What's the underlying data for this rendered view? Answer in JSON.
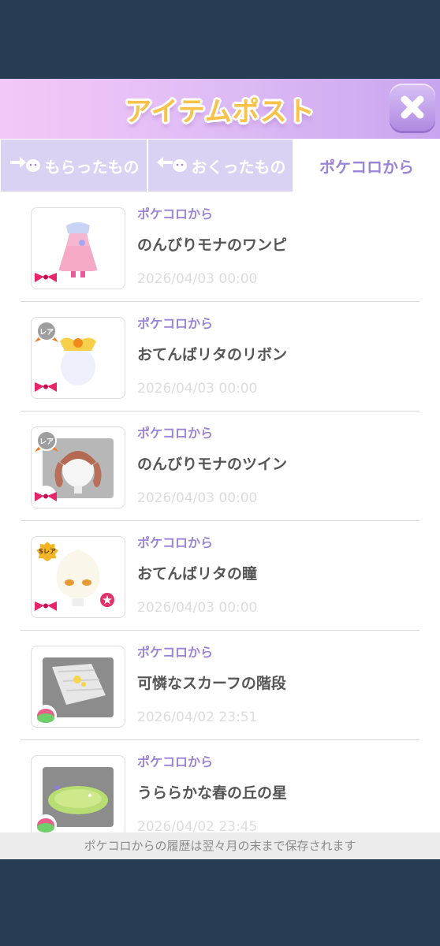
{
  "header": {
    "title": "アイテムポスト"
  },
  "tabs": [
    {
      "label": "もらったもの",
      "icon": "received-arrow-icon",
      "active": false
    },
    {
      "label": "おくったもの",
      "icon": "sent-arrow-icon",
      "active": false
    },
    {
      "label": "ポケコロから",
      "active": true
    }
  ],
  "items": [
    {
      "source": "ポケコロから",
      "name": "のんびりモナのワンピ",
      "date": "2026/04/03 00:00",
      "rarity": "",
      "thumb": "pink-dress"
    },
    {
      "source": "ポケコロから",
      "name": "おてんばリタのリボン",
      "date": "2026/04/03 00:00",
      "rarity": "レア",
      "thumb": "ribbon"
    },
    {
      "source": "ポケコロから",
      "name": "のんびりモナのツイン",
      "date": "2026/04/03 00:00",
      "rarity": "レア",
      "thumb": "twin-hair"
    },
    {
      "source": "ポケコロから",
      "name": "おてんばリタの瞳",
      "date": "2026/04/03 00:00",
      "rarity": "Sレア",
      "thumb": "eyes"
    },
    {
      "source": "ポケコロから",
      "name": "可憐なスカーフの階段",
      "date": "2026/04/02 23:51",
      "rarity": "",
      "thumb": "scarf-stairs"
    },
    {
      "source": "ポケコロから",
      "name": "うららかな春の丘の星",
      "date": "2026/04/02 23:45",
      "rarity": "",
      "thumb": "spring-hill"
    }
  ],
  "footer": {
    "note": "ポケコロからの履歴は翌々月の末まで保存されます"
  },
  "colors": {
    "accent": "#9b84d6",
    "tab_bg": "#d9d2f2",
    "background": "#263d54"
  }
}
